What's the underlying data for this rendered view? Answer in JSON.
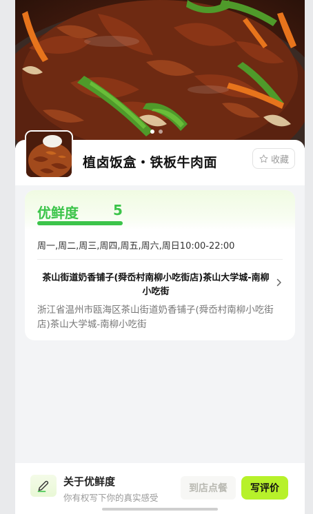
{
  "hero": {
    "image": "tiebang-beef-photo",
    "pager": {
      "count": 2,
      "active": 0
    }
  },
  "header": {
    "title": "植卤饭盒・铁板牛肉面",
    "thumb": "dish-thumbnail",
    "favorite_label": "收藏",
    "favorite_icon": "star-outline-icon"
  },
  "freshness": {
    "label": "优鲜度",
    "score": "5",
    "score_fraction": 1.0,
    "color": "#3cc44a"
  },
  "shop": {
    "hours": "周一,周二,周三,周四,周五,周六,周日10:00-22:00",
    "name": "茶山街道奶香铺子(舜岙村南柳小吃街店)茶山大学城-南柳小吃街",
    "address": "浙江省温州市瓯海区茶山街道奶香铺子(舜岙村南柳小吃街店)茶山大学城-南柳小吃街"
  },
  "bottom": {
    "pen_icon": "pen-icon",
    "about_title": "关于优鲜度",
    "about_subtitle": "你有权写下你的真实感受",
    "visit_label": "到店点餐",
    "review_label": "写评价",
    "accent": "#b7f12a"
  }
}
